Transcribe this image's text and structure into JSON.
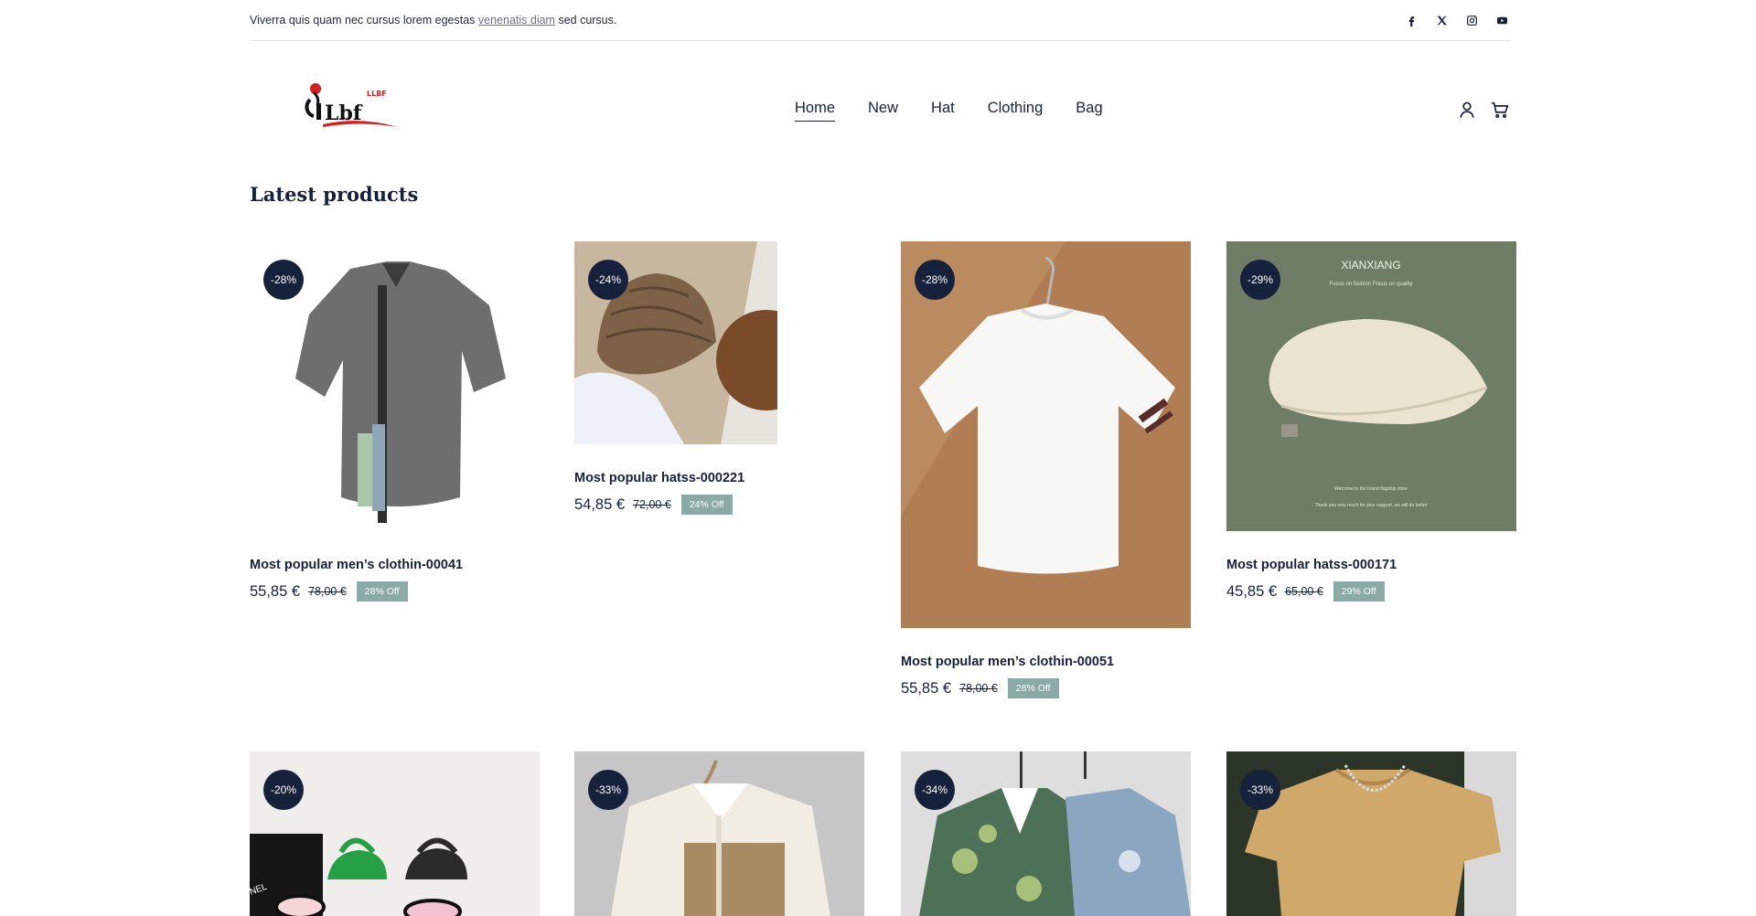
{
  "topbar": {
    "message_before": "Viverra quis quam nec cursus lorem egestas ",
    "message_link": "venenatis diam",
    "message_after": " sed cursus.",
    "social": [
      "facebook-icon",
      "x-icon",
      "instagram-icon",
      "youtube-icon"
    ]
  },
  "brand": {
    "logo_text": "Lbf",
    "logo_sup": "LLBF"
  },
  "nav": {
    "items": [
      "Home",
      "New",
      "Hat",
      "Clothing",
      "Bag"
    ],
    "active": "Home"
  },
  "header_icons": [
    "account-icon",
    "cart-icon"
  ],
  "section_title": "Latest products",
  "products": [
    {
      "badge": "-28%",
      "title": "Most popular men’s clothin-00041",
      "price": "55,85 €",
      "old_price": "78,00 €",
      "off": "28% Off"
    },
    {
      "badge": "-24%",
      "title": "Most popular hatss-000221",
      "price": "54,85 €",
      "old_price": "72,00 €",
      "off": "24% Off"
    },
    {
      "badge": "-28%",
      "title": "Most popular men’s clothin-00051",
      "price": "55,85 €",
      "old_price": "78,00 €",
      "off": "28% Off"
    },
    {
      "badge": "-29%",
      "title": "Most popular hatss-000171",
      "price": "45,85 €",
      "old_price": "65,00 €",
      "off": "29% Off",
      "image_heading": "XIANXIANG",
      "image_sub": "Focus on fashion  Focus on quality",
      "image_foot1": "Welcome to the brand flagship store",
      "image_foot2": "Thank you very much for your support, we will do better"
    },
    {
      "badge": "-20%",
      "image_text": "NEL"
    },
    {
      "badge": "-33%"
    },
    {
      "badge": "-34%"
    },
    {
      "badge": "-33%"
    }
  ],
  "colors": {
    "navy": "#16213b",
    "off_badge": "#8aaaa5",
    "hat_bg": "#6f7d66",
    "tshirt_bg": "#b07e52"
  }
}
